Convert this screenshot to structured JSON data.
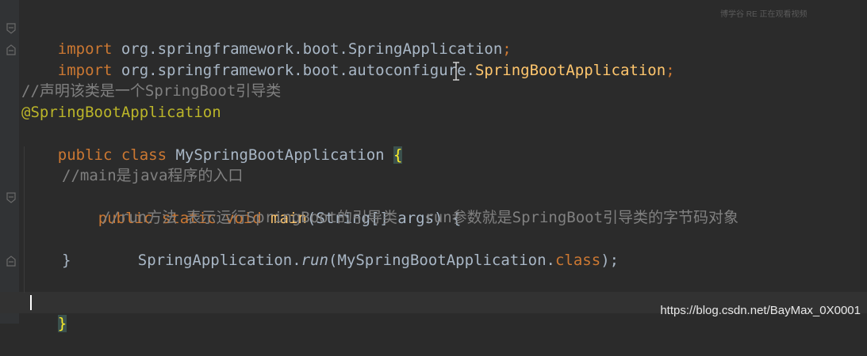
{
  "code": {
    "line1": {
      "kw": "import",
      "rest": " org.springframework.boot.SpringApplication",
      "semi": ";"
    },
    "line2": {
      "kw": "import",
      "rest_pkg": " org.springframework.boot.autoconfigure.",
      "cls": "SpringBootApplication",
      "semi": ";"
    },
    "line4": "//声明该类是一个SpringBoot引导类",
    "line5": "@SpringBootApplication",
    "line6": {
      "kw": "public class",
      "name": " MySpringBootApplication ",
      "brace": "{"
    },
    "line8": "//main是java程序的入口",
    "line9": {
      "kw": "public static void",
      "fn": " main",
      "rest": "(String[] args) {"
    },
    "line10": "//run方法 表示运行SpringBoot的引导类   run参数就是SpringBoot引导类的字节码对象",
    "line11": {
      "pre": "SpringApplication.",
      "method": "run",
      "args": "(MySpringBootApplication.",
      "kw": "class",
      "end": ");"
    },
    "line12": "}",
    "line14": "}"
  },
  "top_ghost_text": "博学谷 RE 正在观看视频",
  "watermark": "https://blog.csdn.net/BayMax_0X0001",
  "colors": {
    "background": "#2b2b2b",
    "keyword": "#cc7832",
    "comment": "#808080",
    "annotation": "#bbb529",
    "method": "#ffc66d",
    "text": "#a9b7c6"
  }
}
